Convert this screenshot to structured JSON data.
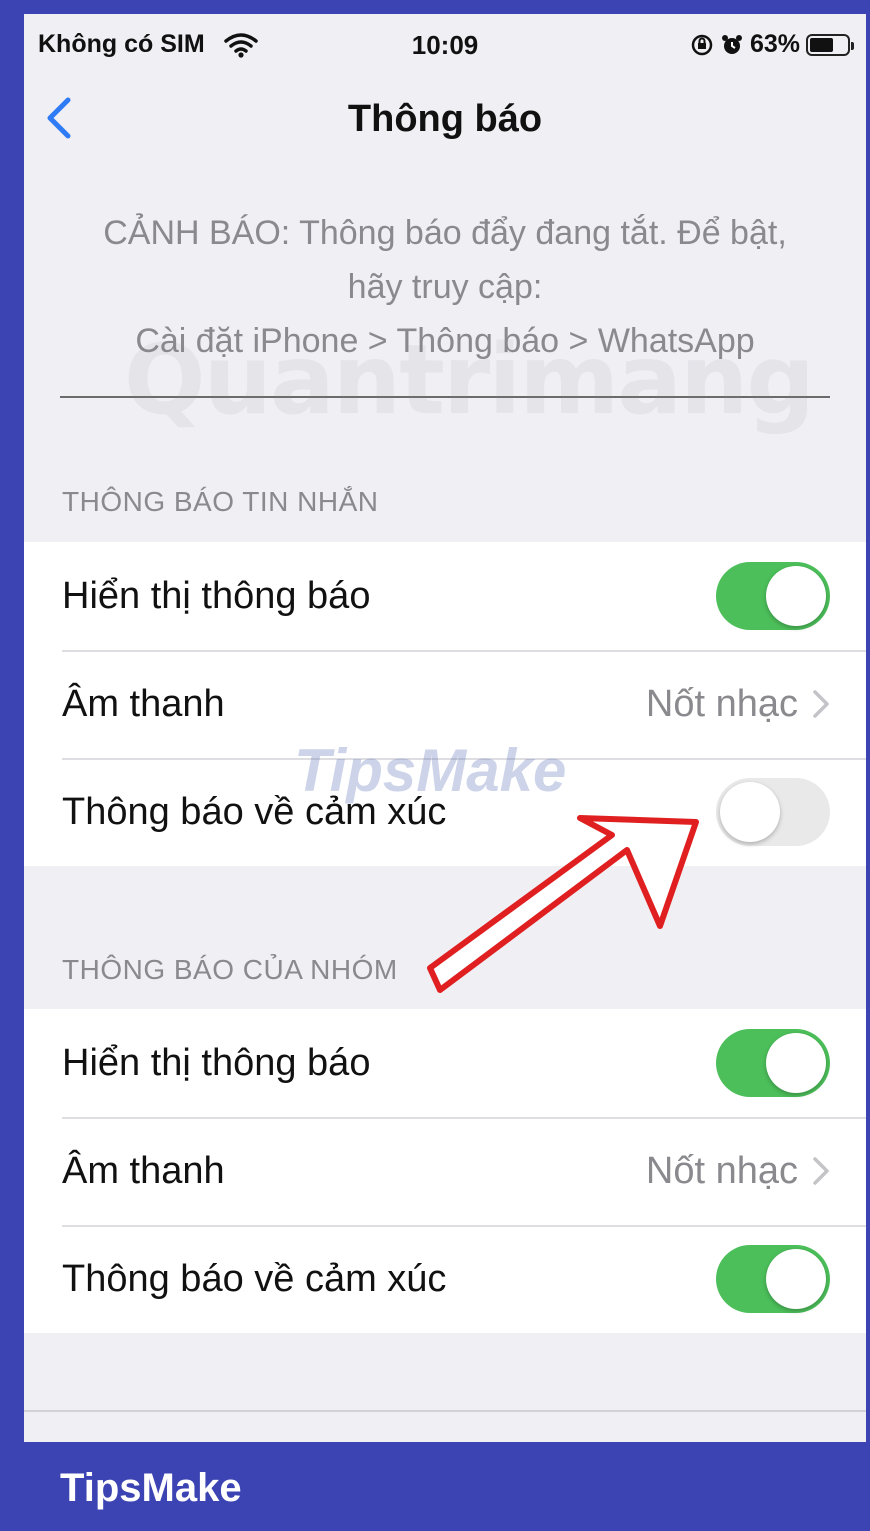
{
  "status_bar": {
    "carrier": "Không có SIM",
    "time": "10:09",
    "battery": "63%"
  },
  "nav": {
    "title": "Thông báo"
  },
  "warning": {
    "line1": "CẢNH BÁO: Thông báo đẩy đang tắt. Để bật,",
    "line2": "hãy truy cập:",
    "line3": "Cài đặt iPhone > Thông báo > WhatsApp"
  },
  "message_section": {
    "header": "THÔNG BÁO TIN NHẮN",
    "rows": [
      {
        "label": "Hiển thị thông báo",
        "toggle": "on"
      },
      {
        "label": "Âm thanh",
        "value": "Nốt nhạc"
      },
      {
        "label": "Thông báo về cảm xúc",
        "toggle": "off"
      }
    ]
  },
  "group_section": {
    "header": "THÔNG BÁO CỦA NHÓM",
    "rows": [
      {
        "label": "Hiển thị thông báo",
        "toggle": "on"
      },
      {
        "label": "Âm thanh",
        "value": "Nốt nhạc"
      },
      {
        "label": "Thông báo về cảm xúc",
        "toggle": "on"
      }
    ]
  },
  "watermarks": {
    "quantrimang": "Quantrimang",
    "tipsmake": "TipsMake"
  },
  "brand": "TipsMake",
  "colors": {
    "toggle_on": "#4cbf5a",
    "accent": "#2f7bf5",
    "frame": "#3c44b4",
    "annotation_arrow": "#e02020"
  }
}
